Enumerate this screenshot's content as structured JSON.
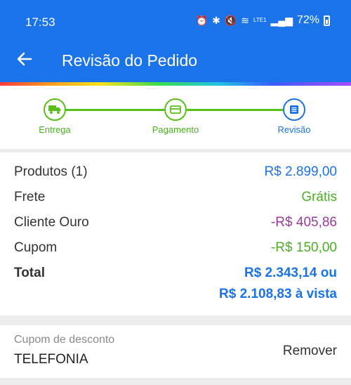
{
  "status_bar": {
    "time": "17:53",
    "battery": "72%",
    "network": "LTE1",
    "icons": [
      "alarm-icon",
      "bluetooth-icon",
      "mute-icon",
      "wifi-icon",
      "signal-icon",
      "battery-icon"
    ]
  },
  "header": {
    "title": "Revisão do Pedido",
    "back_icon": "arrow-left-icon"
  },
  "stepper": {
    "steps": [
      {
        "label": "Entrega",
        "icon": "truck-icon",
        "state": "done"
      },
      {
        "label": "Pagamento",
        "icon": "card-icon",
        "state": "done"
      },
      {
        "label": "Revisão",
        "icon": "list-icon",
        "state": "active"
      }
    ]
  },
  "summary": {
    "rows": [
      {
        "label": "Produtos (1)",
        "value": "R$ 2.899,00"
      },
      {
        "label": "Frete",
        "value": "Grátis"
      },
      {
        "label": "Cliente Ouro",
        "value": "-R$ 405,86"
      },
      {
        "label": "Cupom",
        "value": "-R$ 150,00"
      }
    ],
    "total": {
      "label": "Total",
      "value_line1": "R$ 2.343,14 ou",
      "value_line2": "R$ 2.108,83 à vista"
    }
  },
  "coupon": {
    "caption": "Cupom de desconto",
    "code": "TELEFONIA",
    "action": "Remover"
  },
  "colors": {
    "primary": "#1a73e8",
    "success": "#4caf24",
    "discount_purple": "#9b3a9c"
  }
}
